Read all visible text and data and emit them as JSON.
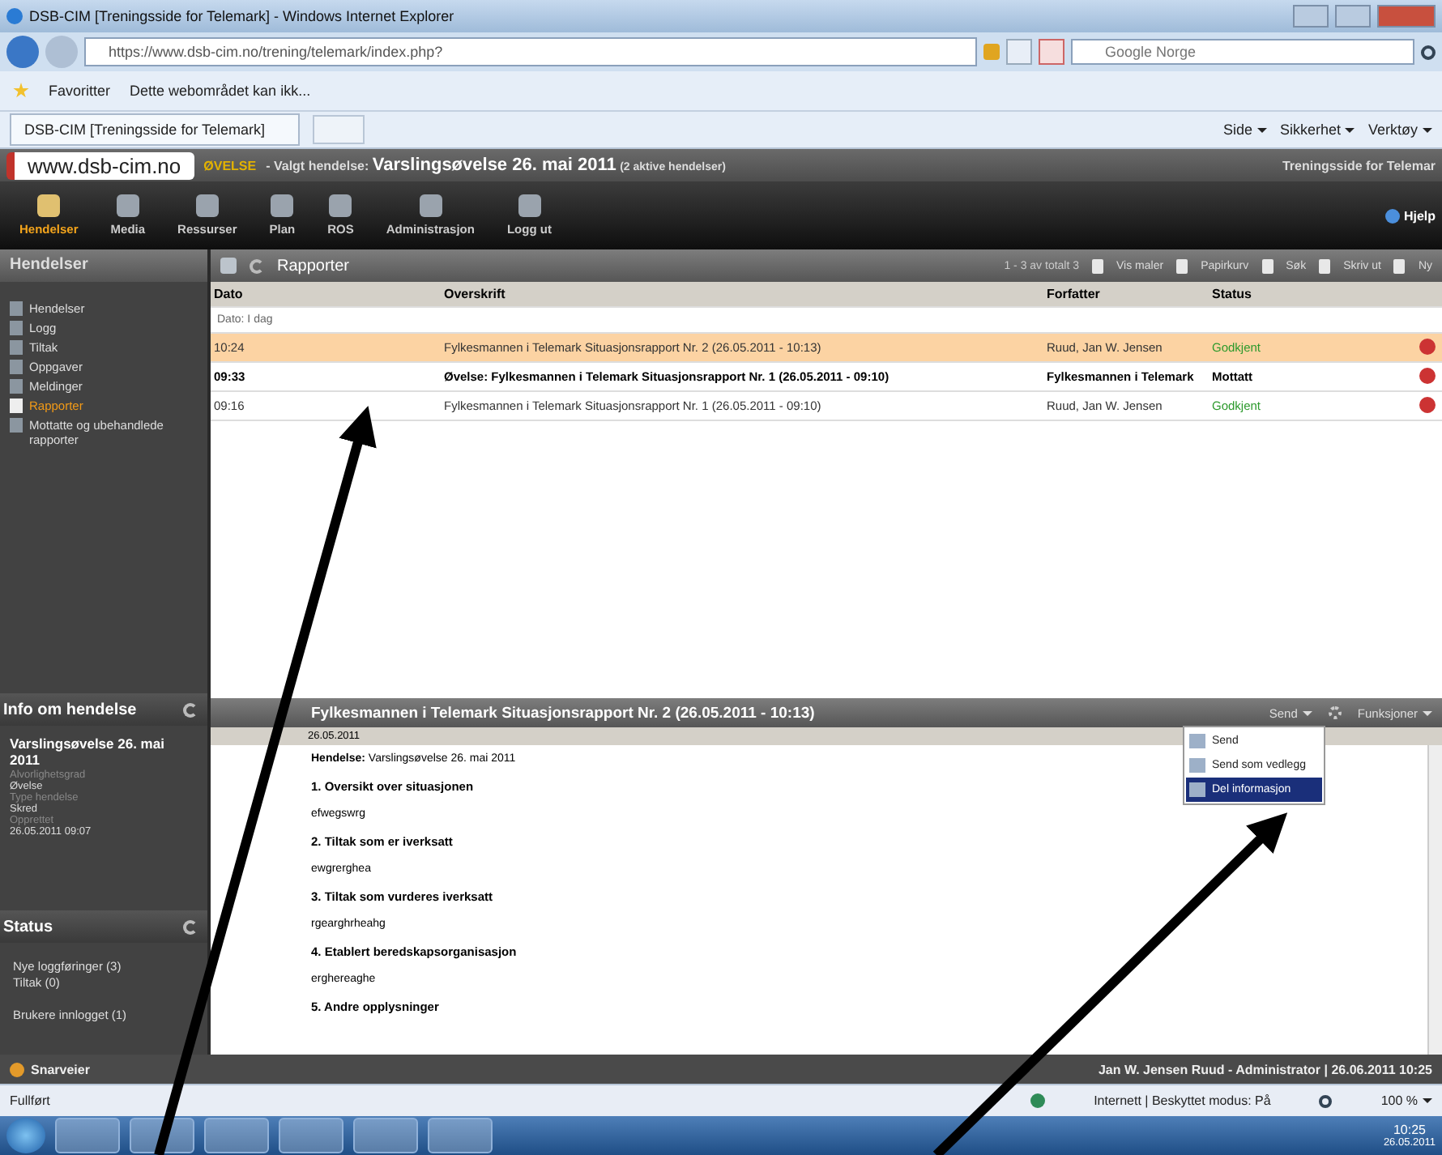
{
  "browser": {
    "title": "DSB-CIM [Treningsside for Telemark] - Windows Internet Explorer",
    "address": "https://www.dsb-cim.no/trening/telemark/index.php?",
    "search_placeholder": "Google Norge",
    "favorites": "Favoritter",
    "favorite_link": "Dette webområdet kan ikk...",
    "tab": "DSB-CIM [Treningsside for Telemark]",
    "commands": [
      "Side",
      "Sikkerhet",
      "Verktøy"
    ]
  },
  "app": {
    "logo": "www.dsb-cim.no",
    "badge": "ØVELSE",
    "banner_label": "- Valgt hendelse:",
    "banner_event": "Varslingsøvelse 26. mai 2011",
    "banner_count": "(2 aktive hendelser)",
    "site": "Treningsside for Telemar"
  },
  "toolbar": [
    {
      "label": "Hendelser",
      "selected": true
    },
    {
      "label": "Media",
      "selected": false
    },
    {
      "label": "Ressurser",
      "selected": false
    },
    {
      "label": "Plan",
      "selected": false
    },
    {
      "label": "ROS",
      "selected": false
    },
    {
      "label": "Administrasjon",
      "selected": false
    },
    {
      "label": "Logg ut",
      "selected": false
    }
  ],
  "help": "Hjelp",
  "sidebar": {
    "title": "Hendelser",
    "items": [
      {
        "label": "Hendelser",
        "selected": false
      },
      {
        "label": "Logg",
        "selected": false
      },
      {
        "label": "Tiltak",
        "selected": false
      },
      {
        "label": "Oppgaver",
        "selected": false
      },
      {
        "label": "Meldinger",
        "selected": false
      },
      {
        "label": "Rapporter",
        "selected": true
      },
      {
        "label": "Mottatte og ubehandlede rapporter",
        "selected": false
      }
    ]
  },
  "info": {
    "title": "Info om hendelse",
    "event": "Varslingsøvelse 26. mai 2011",
    "fields": [
      {
        "label": "Alvorlighetsgrad",
        "value": "Øvelse"
      },
      {
        "label": "Type hendelse",
        "value": "Skred"
      },
      {
        "label": "Opprettet",
        "value": "26.05.2011 09:07"
      }
    ]
  },
  "status": {
    "title": "Status",
    "items": [
      "Nye loggføringer (3)",
      "Tiltak (0)",
      "Brukere innlogget (1)"
    ]
  },
  "reports": {
    "title": "Rapporter",
    "pager": "1 - 3 av totalt 3",
    "actions": [
      "Vis maler",
      "Papirkurv",
      "Søk",
      "Skriv ut",
      "Ny"
    ],
    "columns": [
      "Dato",
      "Overskrift",
      "Forfatter",
      "Status"
    ],
    "group": "Dato: I dag",
    "rows": [
      {
        "time": "10:24",
        "title": "Fylkesmannen i Telemark Situasjonsrapport Nr. 2 (26.05.2011 - 10:13)",
        "author": "Ruud, Jan W. Jensen",
        "status": "Godkjent",
        "approved": true,
        "unread": false,
        "selected": true
      },
      {
        "time": "09:33",
        "title": "Øvelse: Fylkesmannen i Telemark Situasjonsrapport Nr. 1 (26.05.2011 - 09:10)",
        "author": "Fylkesmannen i Telemark",
        "status": "Mottatt",
        "approved": false,
        "unread": true,
        "selected": false
      },
      {
        "time": "09:16",
        "title": "Fylkesmannen i Telemark Situasjonsrapport Nr. 1 (26.05.2011 - 09:10)",
        "author": "Ruud, Jan W. Jensen",
        "status": "Godkjent",
        "approved": true,
        "unread": false,
        "selected": false
      }
    ]
  },
  "detail": {
    "title": "Fylkesmannen i Telemark Situasjonsrapport Nr. 2 (26.05.2011 - 10:13)",
    "date": "26.05.2011",
    "send": "Send",
    "functions": "Funksjoner",
    "menu": [
      {
        "label": "Send",
        "selected": false
      },
      {
        "label": "Send som vedlegg",
        "selected": false
      },
      {
        "label": "Del informasjon",
        "selected": true
      }
    ],
    "body": [
      {
        "kind": "text",
        "text": "**Hendelse:** Varslingsøvelse 26. mai 2011"
      },
      {
        "kind": "heading",
        "text": "1. Oversikt over situasjonen"
      },
      {
        "kind": "text",
        "text": "efwegswrg"
      },
      {
        "kind": "heading",
        "text": "2. Tiltak som er iverksatt"
      },
      {
        "kind": "text",
        "text": "ewgrerghea"
      },
      {
        "kind": "heading",
        "text": "3. Tiltak som vurderes iverksatt"
      },
      {
        "kind": "text",
        "text": "rgearghrheahg"
      },
      {
        "kind": "heading",
        "text": "4. Etablert beredskapsorganisasjon"
      },
      {
        "kind": "text",
        "text": "erghereaghe"
      },
      {
        "kind": "heading",
        "text": "5. Andre opplysninger"
      }
    ]
  },
  "footer": {
    "shortcuts": "Snarveier",
    "user": "Jan W. Jensen Ruud - Administrator | 26.06.2011 10:25"
  },
  "ie_status": {
    "text": "Fullført",
    "zone": "Internett | Beskyttet modus: På",
    "zoom": "100 %"
  },
  "taskbar": {
    "time": "10:25",
    "date": "26.05.2011"
  }
}
